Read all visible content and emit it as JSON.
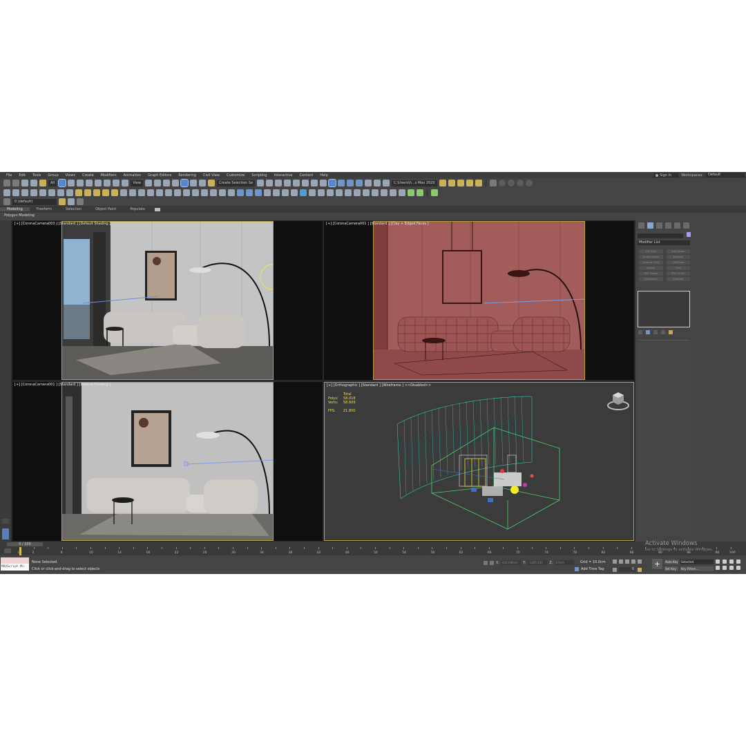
{
  "menubar": {
    "items": [
      "File",
      "Edit",
      "Tools",
      "Group",
      "Views",
      "Create",
      "Modifiers",
      "Animation",
      "Graph Editors",
      "Rendering",
      "Civil View",
      "Customize",
      "Scripting",
      "Interactive",
      "Content",
      "Help"
    ],
    "sign_in": "Sign In",
    "workspaces_label": "Workspaces:",
    "workspaces_value": "Default"
  },
  "toolbar": {
    "selection_filter": "All",
    "view_dropdown": "View",
    "create_selection_set": "Create Selection Se",
    "project_path": "C:\\Users\\h...s Max 2020"
  },
  "layer": {
    "name": "0 (default)"
  },
  "ribbon": {
    "tabs": [
      "Modeling",
      "Freeform",
      "Selection",
      "Object Paint",
      "Populate"
    ],
    "active_tab": "Modeling",
    "panel_label": "Polygon Modeling"
  },
  "viewports": {
    "top_left": {
      "label": "[+] [CoronaCamera003 ] [Standard ] [Default Shading ]"
    },
    "top_right": {
      "label": "[+] [CoronaCamera001 ] [Standard ] [Clay + Edged Faces ]"
    },
    "bottom_left": {
      "label": "[+] [CoronaCamera001 ] [Standard ] [Default Shading ]"
    },
    "bottom_right": {
      "label": "[+] [Orthographic ] [Standard ] [Wireframe ]  <<Disabled>>",
      "stats": {
        "total_label": "Total",
        "polys_label": "Polys:",
        "polys_value": "58,018",
        "verts_label": "Verts:",
        "verts_value": "58,609",
        "fps_label": "FPS:",
        "fps_value": "21.800"
      }
    }
  },
  "command_panel": {
    "modifier_list": "Modifier List",
    "buttons": [
      "Edit Poly",
      "Edit Spline",
      "TurboSmooth",
      "Extrude",
      "Unwrap UVW",
      "UVW Map",
      "Sweep",
      "Shell",
      "FFD Select",
      "FFD 3x3x3",
      "Symmetry",
      "Chamfer"
    ]
  },
  "timeline": {
    "slider": "0 / 100",
    "ticks": [
      "0",
      "2",
      "6",
      "10",
      "14",
      "18",
      "22",
      "26",
      "30",
      "34",
      "38",
      "42",
      "46",
      "50",
      "54",
      "58",
      "62",
      "66",
      "70",
      "74",
      "78",
      "82",
      "86",
      "90",
      "94",
      "98",
      "100"
    ]
  },
  "status": {
    "maxscript": "MAXScript Mi:",
    "selection": "None Selected",
    "prompt": "Click or click-and-drag to select objects",
    "x_label": "X:",
    "x_value": "631.086cm",
    "y_label": "Y:",
    "y_value": "-1265.242",
    "z_label": "Z:",
    "z_value": "0.0cm",
    "grid": "Grid = 10.0cm",
    "add_time_tag": "Add Time Tag",
    "frame": "0",
    "auto_key": "Auto Key",
    "key_mode": "Selected",
    "set_key": "Set Key",
    "key_filters": "Key Filters..."
  },
  "watermark": {
    "title": "Activate Windows",
    "subtitle": "Go to Settings to activate Windows."
  }
}
